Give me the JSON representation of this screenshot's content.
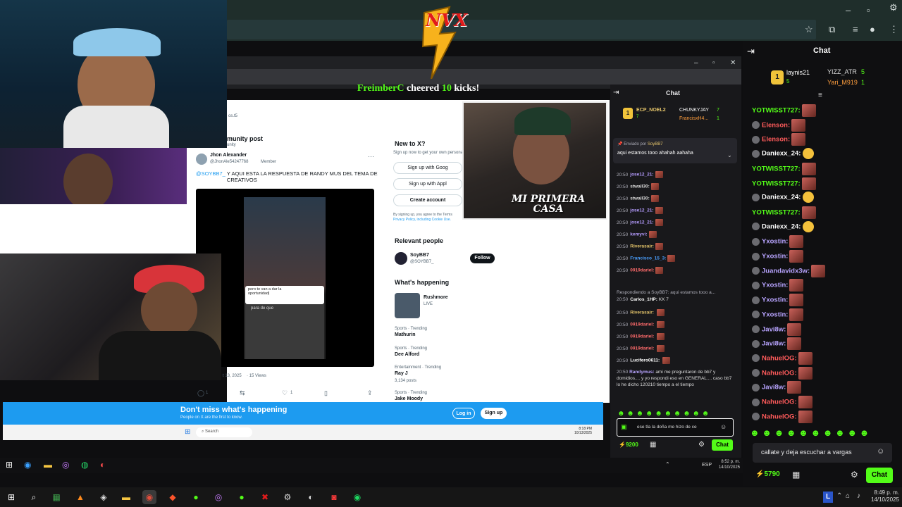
{
  "cheer": {
    "user": "FreimberC",
    "mid": "cheered",
    "amount": "10",
    "unit": "kicks!"
  },
  "overlay_logo": "NVX",
  "cam_caption": "MI PRIMERA CASA",
  "x_page": {
    "tab_title": "munity post",
    "sub_title": "unity",
    "breadcrumb": "os.t5",
    "author_name": "Jhon Alexander",
    "author_handle": "@JhonAle54247768",
    "member_badge": "Member",
    "tweet_handle": "@SOYBB7_",
    "tweet_text": "Y AQUI ESTA LA RESPUESTA DE RANDY MUS DEL TEMA DE CREATIVOS",
    "tweet_text2": "CREATIVOS",
    "date": "t 13, 2025",
    "views": "· 15 Views",
    "reply_count": "1",
    "like_count": "1",
    "new_to_x": "New to X?",
    "signup_note": "Sign up now to get your own personal",
    "signup_google": "Sign up with Goog",
    "signup_apple": "Sign up with Appl",
    "create_account": "Create account",
    "terms": "By signing up, you agree to the Terms",
    "terms2": "Privacy Policy, including Cookie Use.",
    "relevant_people": "Relevant people",
    "person_name": "SoyBB7",
    "person_handle": "@SOYBB7_",
    "follow": "Follow",
    "whats_happening": "What's happening",
    "trend1": "Rushmore",
    "trend1_sub": "LIVE",
    "trend2_cat": "Sports · Trending",
    "trend2": "Mathurin",
    "trend3_cat": "Sports · Trending",
    "trend3": "Dee Alford",
    "trend4_cat": "Entertainment · Trending",
    "trend4": "Ray J",
    "trend4_sub": "3,134 posts",
    "trend5_cat": "Sports · Trending",
    "trend5": "Jake Moody",
    "banner_title": "Don't miss what's happening",
    "banner_sub": "People on X are the first to know.",
    "login": "Log in",
    "signup": "Sign up",
    "phone_text1": "pero te van a dar la",
    "phone_text2": "oportunidad|",
    "phone_keys": "para de que"
  },
  "inner_taskbar": {
    "search": "Search",
    "time": "8:18 PM",
    "date": "10/13/2025"
  },
  "mid_chat": {
    "title": "Chat",
    "top1_user": "ECP_NOEL2",
    "top1_count": "7",
    "top2_user": "CHUNKYJAY",
    "top2_count": "7",
    "top3_user": "FrancisxH4...",
    "top3_count": "1",
    "pinned_by_label": "Enviado por",
    "pinned_by": "SoyBB7",
    "pinned_text": "aqui estamos tooo ahahah aahaha",
    "lines": [
      {
        "t": "20:50",
        "u": "jose12_21:",
        "c": "#b59cff"
      },
      {
        "t": "20:50",
        "u": "stwall30:",
        "c": "#dddddd"
      },
      {
        "t": "20:50",
        "u": "stwall30:",
        "c": "#dddddd"
      },
      {
        "t": "20:50",
        "u": "jose12_21:",
        "c": "#b59cff"
      },
      {
        "t": "20:50",
        "u": "jose12_21:",
        "c": "#b59cff"
      },
      {
        "t": "20:50",
        "u": "kemyvi:",
        "c": "#b59cff"
      },
      {
        "t": "20:50",
        "u": "Riverasair:",
        "c": "#e4c46a"
      },
      {
        "t": "20:50",
        "u": "Francisco_15_3:",
        "c": "#4aa0ff"
      },
      {
        "t": "20:50",
        "u": "0919dariel:",
        "c": "#ff6b6b"
      }
    ],
    "reply_to": "Respondiendo a SoyBB7: aqui estamos tooo a...",
    "lines2": [
      {
        "t": "20:50",
        "u": "Carlos_1HP:",
        "msg": "KK 7",
        "c": "#ffffff"
      },
      {
        "t": "20:50",
        "u": "Riverasair:",
        "msg": "",
        "c": "#e4c46a"
      },
      {
        "t": "20:50",
        "u": "0919dariel:",
        "msg": "",
        "c": "#ff6b6b"
      },
      {
        "t": "20:50",
        "u": "0919dariel:",
        "msg": "",
        "c": "#ff6b6b"
      },
      {
        "t": "20:50",
        "u": "0919dariel:",
        "msg": "",
        "c": "#ff6b6b"
      },
      {
        "t": "20:50",
        "u": "Lucifero0611:",
        "msg": "",
        "c": "#ffffff"
      }
    ],
    "randy_time": "20:50",
    "randy_user": "Randymus:",
    "randy_msg": "ami me preguntaron de bb7 y domidios.... y yo respondi eso en GENERAL.... caso bb7 lo he dicho 120210 tiempo a el tiempo",
    "input_value": "ese tla la doña me hizo de ce",
    "points": "9200",
    "chat_button": "Chat"
  },
  "right_chat": {
    "title": "Chat",
    "top1_user": "laynis21",
    "top1_count": "5",
    "top2_user": "YIZZ_ATR",
    "top2_count": "5",
    "top3_user": "Yari_M919",
    "top3_count": "1",
    "lines": [
      {
        "u": "YOTWISST727:",
        "c": "#53fc18",
        "e": "remo"
      },
      {
        "u": "Elenson:",
        "c": "#ff5b5b",
        "e": "remo"
      },
      {
        "u": "Elenson:",
        "c": "#ff5b5b",
        "e": "remo"
      },
      {
        "u": "Daniexx_24:",
        "c": "#ffffff",
        "e": "smile"
      },
      {
        "u": "YOTWISST727:",
        "c": "#53fc18",
        "e": "remo"
      },
      {
        "u": "YOTWISST727:",
        "c": "#53fc18",
        "e": "remo"
      },
      {
        "u": "Daniexx_24:",
        "c": "#ffffff",
        "e": "smile"
      },
      {
        "u": "YOTWISST727:",
        "c": "#53fc18",
        "e": "remo"
      },
      {
        "u": "Daniexx_24:",
        "c": "#ffffff",
        "e": "smile"
      },
      {
        "u": "Yxostin:",
        "c": "#b8a4ff",
        "e": "remo"
      },
      {
        "u": "Yxostin:",
        "c": "#b8a4ff",
        "e": "remo"
      },
      {
        "u": "Juandavidx3w:",
        "c": "#b8a4ff",
        "e": "remo"
      },
      {
        "u": "Yxostin:",
        "c": "#b8a4ff",
        "e": "remo"
      },
      {
        "u": "Yxostin:",
        "c": "#b8a4ff",
        "e": "remo"
      },
      {
        "u": "Yxostin:",
        "c": "#b8a4ff",
        "e": "remo"
      },
      {
        "u": "Javi8w:",
        "c": "#b8a4ff",
        "e": "remo"
      },
      {
        "u": "Javi8w:",
        "c": "#b8a4ff",
        "e": "remo"
      },
      {
        "u": "NahuelOG:",
        "c": "#ff5b5b",
        "e": "remo"
      },
      {
        "u": "NahuelOG:",
        "c": "#ff5b5b",
        "e": "remo"
      },
      {
        "u": "Javi8w:",
        "c": "#b8a4ff",
        "e": "remo"
      },
      {
        "u": "NahuelOG:",
        "c": "#ff5b5b",
        "e": "remo"
      },
      {
        "u": "NahuelOG:",
        "c": "#ff5b5b",
        "e": "remo"
      }
    ],
    "input_value": "callate y deja escuchar a vargas",
    "points": "5790",
    "chat_button": "Chat"
  },
  "inner_tray": {
    "lang": "ESP",
    "time": "8:52 p. m.",
    "date": "14/10/2025"
  },
  "main_tray": {
    "lang": "ESP",
    "time": "8:49 p. m.",
    "date": "14/10/2025",
    "letter": "L"
  },
  "colors": {
    "kick_green": "#53fc18",
    "x_blue": "#1d9bf0",
    "chat_bg": "#0f0f11"
  }
}
